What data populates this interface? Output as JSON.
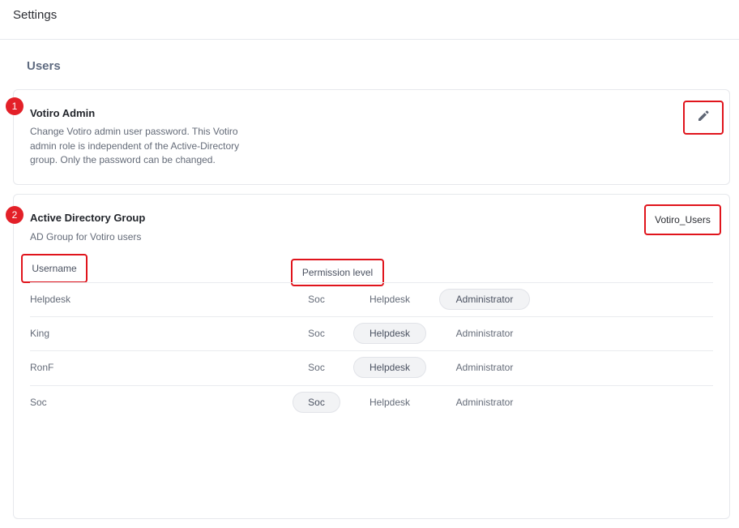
{
  "header": {
    "title": "Settings"
  },
  "section": {
    "title": "Users"
  },
  "admin_card": {
    "step": "1",
    "title": "Votiro Admin",
    "description_lines": [
      "Change Votiro admin user password. This Votiro",
      "admin role is independent of the Active-Directory",
      "group. Only the password can be changed."
    ],
    "edit_icon": "pencil-icon"
  },
  "ad_card": {
    "step": "2",
    "title": "Active Directory Group",
    "description": "AD Group for Votiro users",
    "group_name": "Votiro_Users",
    "columns": {
      "username": "Username",
      "permission": "Permission level"
    },
    "permission_options": [
      "Soc",
      "Helpdesk",
      "Administrator"
    ],
    "rows": [
      {
        "username": "Helpdesk",
        "selected": "Administrator"
      },
      {
        "username": "King",
        "selected": "Helpdesk"
      },
      {
        "username": "RonF",
        "selected": "Helpdesk"
      },
      {
        "username": "Soc",
        "selected": "Soc"
      }
    ]
  },
  "colors": {
    "highlight": "#e0141c",
    "badge": "#e32028",
    "section_title": "#5f6b80"
  }
}
